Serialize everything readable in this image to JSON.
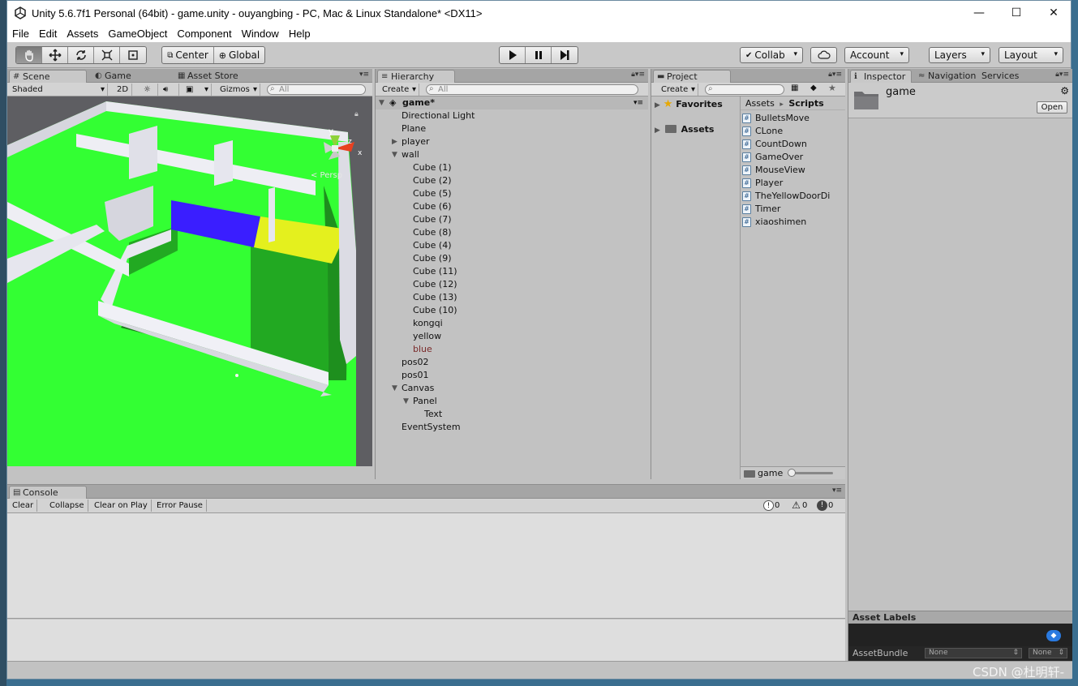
{
  "window": {
    "title": "Unity 5.6.7f1 Personal (64bit) - game.unity - ouyangbing - PC, Mac & Linux Standalone* <DX11>",
    "minimize": "—",
    "maximize": "☐",
    "close": "✕"
  },
  "menu": [
    "File",
    "Edit",
    "Assets",
    "GameObject",
    "Component",
    "Window",
    "Help"
  ],
  "toolbar": {
    "tools": [
      "hand-tool",
      "move-tool",
      "rotate-tool",
      "scale-tool",
      "rect-tool"
    ],
    "pivot": "Center",
    "space": "Global",
    "collab": "Collab",
    "account": "Account",
    "layers": "Layers",
    "layout": "Layout"
  },
  "scene": {
    "tabs": [
      "Scene",
      "Game",
      "Asset Store"
    ],
    "shading": "Shaded",
    "mode2d": "2D",
    "gizmos": "Gizmos",
    "search_placeholder": "All",
    "persp_label": "< Persp",
    "gizmo_y": "y",
    "gizmo_z": "z",
    "gizmo_x": "x"
  },
  "hierarchy": {
    "tab": "Hierarchy",
    "create": "Create",
    "search_placeholder": "All",
    "scene_name": "game*",
    "items": [
      {
        "label": "Directional Light",
        "depth": 1,
        "toggle": ""
      },
      {
        "label": "Plane",
        "depth": 1,
        "toggle": ""
      },
      {
        "label": "player",
        "depth": 1,
        "toggle": "▶"
      },
      {
        "label": "wall",
        "depth": 1,
        "toggle": "▼"
      },
      {
        "label": "Cube (1)",
        "depth": 2,
        "toggle": ""
      },
      {
        "label": "Cube (2)",
        "depth": 2,
        "toggle": ""
      },
      {
        "label": "Cube (5)",
        "depth": 2,
        "toggle": ""
      },
      {
        "label": "Cube (6)",
        "depth": 2,
        "toggle": ""
      },
      {
        "label": "Cube (7)",
        "depth": 2,
        "toggle": ""
      },
      {
        "label": "Cube (8)",
        "depth": 2,
        "toggle": ""
      },
      {
        "label": "Cube (4)",
        "depth": 2,
        "toggle": ""
      },
      {
        "label": "Cube (9)",
        "depth": 2,
        "toggle": ""
      },
      {
        "label": "Cube (11)",
        "depth": 2,
        "toggle": ""
      },
      {
        "label": "Cube (12)",
        "depth": 2,
        "toggle": ""
      },
      {
        "label": "Cube (13)",
        "depth": 2,
        "toggle": ""
      },
      {
        "label": "Cube (10)",
        "depth": 2,
        "toggle": ""
      },
      {
        "label": "kongqi",
        "depth": 2,
        "toggle": ""
      },
      {
        "label": "yellow",
        "depth": 2,
        "toggle": ""
      },
      {
        "label": "blue",
        "depth": 2,
        "toggle": "",
        "color": "#7a2a2a"
      },
      {
        "label": "pos02",
        "depth": 1,
        "toggle": ""
      },
      {
        "label": "pos01",
        "depth": 1,
        "toggle": ""
      },
      {
        "label": "Canvas",
        "depth": 1,
        "toggle": "▼"
      },
      {
        "label": "Panel",
        "depth": 2,
        "toggle": "▼"
      },
      {
        "label": "Text",
        "depth": 3,
        "toggle": ""
      },
      {
        "label": "EventSystem",
        "depth": 1,
        "toggle": ""
      }
    ]
  },
  "project": {
    "tab": "Project",
    "create": "Create",
    "favorites": "Favorites",
    "assets": "Assets",
    "breadcrumb_root": "Assets",
    "breadcrumb_sep": "▸",
    "breadcrumb_current": "Scripts",
    "scripts": [
      "BulletsMove",
      "CLone",
      "CountDown",
      "GameOver",
      "MouseView",
      "Player",
      "TheYellowDoorDi",
      "Timer",
      "xiaoshimen"
    ],
    "footer_path": "game"
  },
  "inspector": {
    "tabs": [
      "Inspector",
      "Navigation",
      "Services"
    ],
    "object_name": "game",
    "open_button": "Open",
    "asset_labels": "Asset Labels",
    "asset_bundle": "AssetBundle",
    "bundle_value": "None",
    "variant_value": "None"
  },
  "console": {
    "tab": "Console",
    "buttons": [
      "Clear",
      "Collapse",
      "Clear on Play",
      "Error Pause"
    ],
    "info_count": "0",
    "warning_count": "0",
    "error_count": "0"
  },
  "watermark": "CSDN @杜明轩-",
  "colors": {
    "floor": "#33ff33",
    "wall": "#eaeaf0",
    "blue_block": "#3a1eff",
    "yellow_block": "#e4f01e"
  }
}
